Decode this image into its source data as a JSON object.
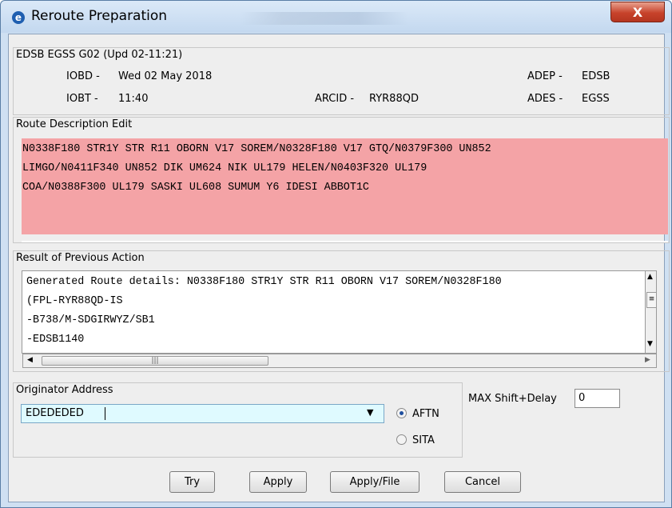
{
  "window": {
    "title": "Reroute Preparation",
    "close_glyph": "X"
  },
  "header": {
    "group_title": "EDSB EGSS G02 (Upd 02-11:21)",
    "iobd_label": "IOBD -",
    "iobd_value": "Wed 02 May 2018",
    "iobt_label": "IOBT -",
    "iobt_value": "11:40",
    "arcid_label": "ARCID -",
    "arcid_value": "RYR88QD",
    "adep_label": "ADEP -",
    "adep_value": "EDSB",
    "ades_label": "ADES -",
    "ades_value": "EGSS"
  },
  "route_edit": {
    "title": "Route Description Edit",
    "lines": [
      "N0338F180 STR1Y STR R11 OBORN V17 SOREM/N0328F180 V17 GTQ/N0379F300 UN852",
      "LIMGO/N0411F340 UN852 DIK UM624 NIK UL179 HELEN/N0403F320 UL179",
      "COA/N0388F300 UL179 SASKI UL608 SUMUM Y6 IDESI ABBOT1C"
    ]
  },
  "result": {
    "title": "Result of Previous Action",
    "lines": [
      "Generated Route details: N0338F180 STR1Y STR R11 OBORN V17 SOREM/N0328F180",
      "(FPL-RYR88QD-IS",
      "-B738/M-SDGIRWYZ/SB1",
      "-EDSB1140"
    ]
  },
  "originator": {
    "title": "Originator Address",
    "value": "EDEDEDED",
    "options": [
      "AFTN",
      "SITA"
    ],
    "selected": "AFTN"
  },
  "max_shift": {
    "label": "MAX Shift+Delay",
    "value": "0"
  },
  "buttons": {
    "try": "Try",
    "apply": "Apply",
    "apply_file": "Apply/File",
    "cancel": "Cancel"
  },
  "colors": {
    "route_highlight": "#f4a3a6",
    "combo_bg": "#dffaff",
    "close_button": "#c7432b"
  }
}
